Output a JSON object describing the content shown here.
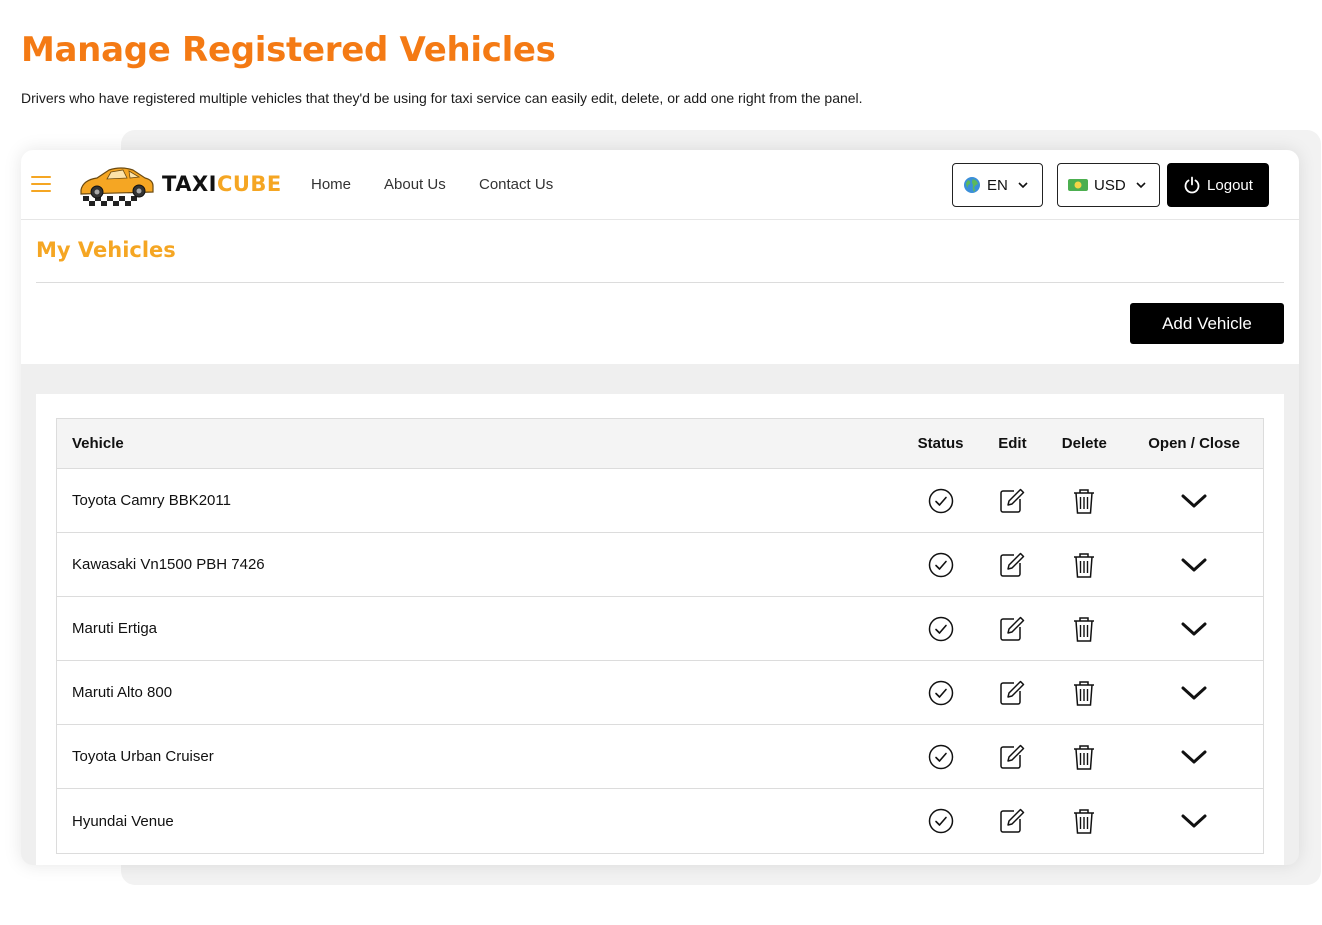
{
  "page": {
    "title": "Manage Registered Vehicles",
    "subtitle": "Drivers who have registered multiple vehicles that they'd be using for taxi service can easily edit, delete, or add one right from the panel."
  },
  "brand": {
    "name_part1": "TAXI",
    "name_part2": "CUBE",
    "accent": "#f5a623",
    "title_color": "#f47a14"
  },
  "nav": {
    "home": "Home",
    "about": "About Us",
    "contact": "Contact Us"
  },
  "language": {
    "value": "EN",
    "icon": "globe-icon"
  },
  "currency": {
    "value": "USD",
    "icon": "banknote-icon"
  },
  "logout_label": "Logout",
  "section": {
    "title": "My Vehicles",
    "add_label": "Add Vehicle"
  },
  "table": {
    "headers": {
      "vehicle": "Vehicle",
      "status": "Status",
      "edit": "Edit",
      "delete": "Delete",
      "open_close": "Open / Close"
    },
    "rows": [
      {
        "vehicle": "Toyota Camry BBK2011"
      },
      {
        "vehicle": "Kawasaki Vn1500 PBH 7426"
      },
      {
        "vehicle": "Maruti Ertiga"
      },
      {
        "vehicle": "Maruti Alto 800"
      },
      {
        "vehicle": "Toyota Urban Cruiser"
      },
      {
        "vehicle": "Hyundai Venue"
      }
    ]
  }
}
